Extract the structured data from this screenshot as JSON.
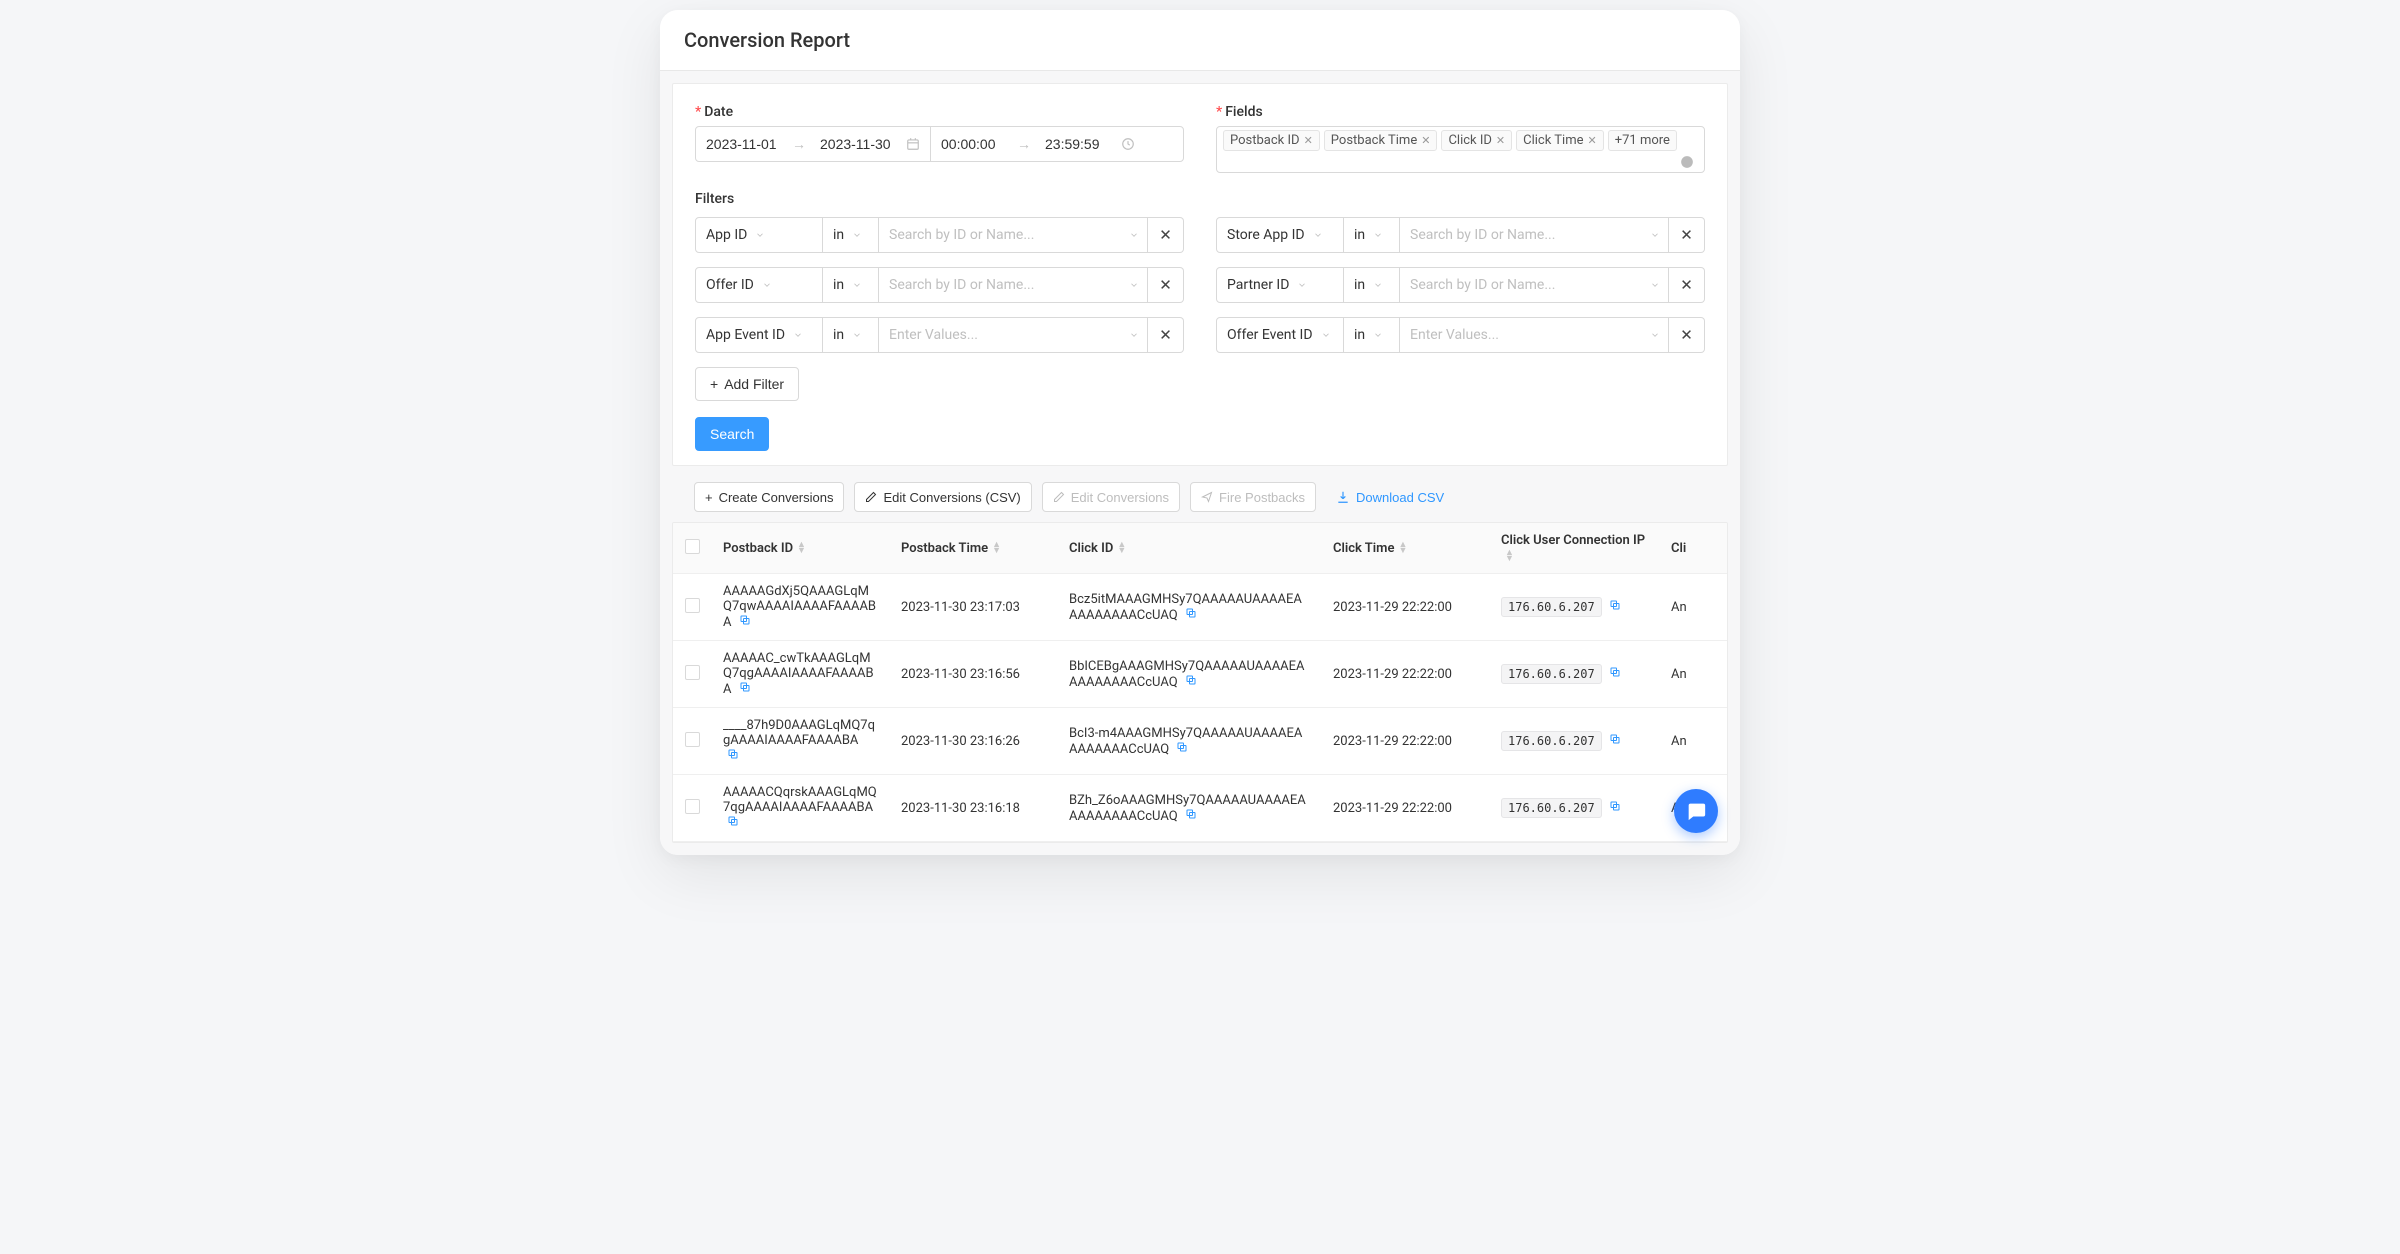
{
  "page": {
    "title": "Conversion Report"
  },
  "date": {
    "label": "Date",
    "start": "2023-11-01",
    "end": "2023-11-30",
    "time_start": "00:00:00",
    "time_end": "23:59:59"
  },
  "fields": {
    "label": "Fields",
    "tags": [
      "Postback ID",
      "Postback Time",
      "Click ID",
      "Click Time"
    ],
    "more": "+71 more"
  },
  "filters": {
    "label": "Filters",
    "op": "in",
    "placeholder_id_name": "Search by ID or Name...",
    "placeholder_values": "Enter Values...",
    "rows": [
      {
        "left": "App ID",
        "right": "Store App ID",
        "type": "search"
      },
      {
        "left": "Offer ID",
        "right": "Partner ID",
        "type": "search"
      },
      {
        "left": "App Event ID",
        "right": "Offer Event ID",
        "type": "values"
      }
    ],
    "add": "Add Filter",
    "search": "Search"
  },
  "toolbar": {
    "create": "Create Conversions",
    "edit_csv": "Edit Conversions (CSV)",
    "edit": "Edit Conversions",
    "fire": "Fire Postbacks",
    "download": "Download CSV"
  },
  "table": {
    "columns": [
      "Postback ID",
      "Postback Time",
      "Click ID",
      "Click Time",
      "Click User Connection IP",
      "Cli"
    ],
    "rows": [
      {
        "postback_id": "AAAAAGdXj5QAAAGLqMQ7qwAAAAIAAAAFAAAABA",
        "postback_time": "2023-11-30 23:17:03",
        "click_id": "Bcz5itMAAAGMHSy7QAAAAAUAAAAEAAAAAAAAACcUAQ",
        "click_time": "2023-11-29 22:22:00",
        "ip": "176.60.6.207",
        "last": "An"
      },
      {
        "postback_id": "AAAAAC_cwTkAAAGLqMQ7qgAAAAIAAAAFAAAABA",
        "postback_time": "2023-11-30 23:16:56",
        "click_id": "BbICEBgAAAGMHSy7QAAAAAUAAAAEAAAAAAAAACcUAQ",
        "click_time": "2023-11-29 22:22:00",
        "ip": "176.60.6.207",
        "last": "An"
      },
      {
        "postback_id": "____87h9D0AAAGLqMQ7qgAAAAIAAAAFAAAABA",
        "postback_time": "2023-11-30 23:16:26",
        "click_id": "BcI3-m4AAAGMHSy7QAAAAAUAAAAEAAAAAAAACcUAQ",
        "click_time": "2023-11-29 22:22:00",
        "ip": "176.60.6.207",
        "last": "An"
      },
      {
        "postback_id": "AAAAACQqrskAAAGLqMQ7qgAAAAIAAAAFAAAABA",
        "postback_time": "2023-11-30 23:16:18",
        "click_id": "BZh_Z6oAAAGMHSy7QAAAAAUAAAAEAAAAAAAAACcUAQ",
        "click_time": "2023-11-29 22:22:00",
        "ip": "176.60.6.207",
        "last": "An"
      }
    ]
  }
}
